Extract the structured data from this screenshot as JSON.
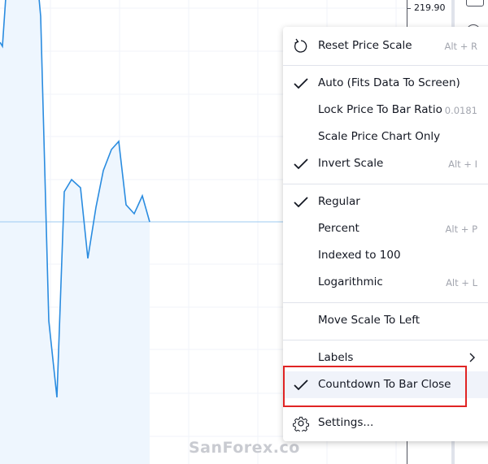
{
  "price_axis": {
    "label": "219.90"
  },
  "chart": {
    "line_color": "#2a8ce0",
    "fill_color": "#eef6fe"
  },
  "menu": {
    "items": [
      {
        "label": "Reset Price Scale",
        "shortcut": "Alt + R",
        "icon": "reset-icon"
      },
      {
        "label": "Auto (Fits Data To Screen)",
        "checked": true
      },
      {
        "label": "Lock Price To Bar Ratio",
        "shortcut": "0.0181"
      },
      {
        "label": "Scale Price Chart Only"
      },
      {
        "label": "Invert Scale",
        "shortcut": "Alt + I",
        "checked": true
      },
      {
        "label": "Regular",
        "checked": true
      },
      {
        "label": "Percent",
        "shortcut": "Alt + P"
      },
      {
        "label": "Indexed to 100"
      },
      {
        "label": "Logarithmic",
        "shortcut": "Alt + L"
      },
      {
        "label": "Move Scale To Left"
      },
      {
        "label": "Labels",
        "submenu": true
      },
      {
        "label": "Countdown To Bar Close",
        "checked": true,
        "highlighted": true
      },
      {
        "label": "Settings...",
        "icon": "gear-icon"
      }
    ]
  },
  "watermark": "SanForex.co",
  "highlight_color": "#e02424"
}
